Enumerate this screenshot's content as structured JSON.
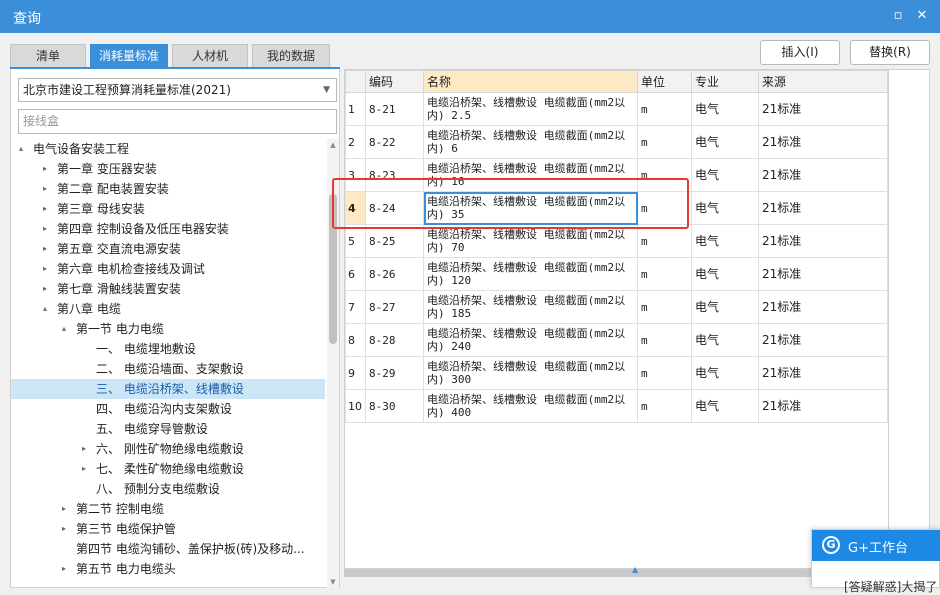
{
  "window": {
    "title": "查询",
    "minimize_icon": "minimize-icon",
    "close_icon": "close-icon"
  },
  "tabs": [
    {
      "label": "清单"
    },
    {
      "label": "消耗量标准"
    },
    {
      "label": "人材机"
    },
    {
      "label": "我的数据"
    }
  ],
  "toolbar": {
    "insert_label": "插入(I)",
    "replace_label": "替换(R)"
  },
  "left": {
    "standard_select": "北京市建设工程预算消耗量标准(2021)",
    "search_placeholder": "接线盒",
    "tree": [
      {
        "label": "电气设备安装工程",
        "exp": "▴"
      },
      {
        "label": "第一章 变压器安装",
        "exp": "▸"
      },
      {
        "label": "第二章 配电装置安装",
        "exp": "▸"
      },
      {
        "label": "第三章 母线安装",
        "exp": "▸"
      },
      {
        "label": "第四章 控制设备及低压电器安装",
        "exp": "▸"
      },
      {
        "label": "第五章 交直流电源安装",
        "exp": "▸"
      },
      {
        "label": "第六章 电机检查接线及调试",
        "exp": "▸"
      },
      {
        "label": "第七章 滑触线装置安装",
        "exp": "▸"
      },
      {
        "label": "第八章 电缆",
        "exp": "▴"
      },
      {
        "label": "第一节 电力电缆",
        "exp": "▴"
      },
      {
        "label": "一、 电缆埋地敷设",
        "exp": ""
      },
      {
        "label": "二、 电缆沿墙面、支架敷设",
        "exp": ""
      },
      {
        "label": "三、 电缆沿桥架、线槽敷设",
        "exp": ""
      },
      {
        "label": "四、 电缆沿沟内支架敷设",
        "exp": ""
      },
      {
        "label": "五、 电缆穿导管敷设",
        "exp": ""
      },
      {
        "label": "六、 刚性矿物绝缘电缆敷设",
        "exp": "▸"
      },
      {
        "label": "七、 柔性矿物绝缘电缆敷设",
        "exp": "▸"
      },
      {
        "label": "八、 预制分支电缆敷设",
        "exp": ""
      },
      {
        "label": "第二节 控制电缆",
        "exp": "▸"
      },
      {
        "label": "第三节 电缆保护管",
        "exp": "▸"
      },
      {
        "label": "第四节 电缆沟铺砂、盖保护板(砖)及移动...",
        "exp": ""
      },
      {
        "label": "第五节 电力电缆头",
        "exp": "▸"
      }
    ]
  },
  "grid": {
    "headers": [
      "",
      "编码",
      "名称",
      "单位",
      "专业",
      "来源"
    ],
    "rows": [
      {
        "idx": "1",
        "code": "8-21",
        "name1": "电缆沿桥架、线槽敷设 电缆截面(mm2以",
        "name2": "内) 2.5",
        "unit": "m",
        "major": "电气",
        "source": "21标准"
      },
      {
        "idx": "2",
        "code": "8-22",
        "name1": "电缆沿桥架、线槽敷设 电缆截面(mm2以",
        "name2": "内) 6",
        "unit": "m",
        "major": "电气",
        "source": "21标准"
      },
      {
        "idx": "3",
        "code": "8-23",
        "name1": "电缆沿桥架、线槽敷设 电缆截面(mm2以",
        "name2": "内) 16",
        "unit": "m",
        "major": "电气",
        "source": "21标准"
      },
      {
        "idx": "4",
        "code": "8-24",
        "name1": "电缆沿桥架、线槽敷设 电缆截面(mm2以",
        "name2": "内) 35",
        "unit": "m",
        "major": "电气",
        "source": "21标准"
      },
      {
        "idx": "5",
        "code": "8-25",
        "name1": "电缆沿桥架、线槽敷设 电缆截面(mm2以",
        "name2": "内) 70",
        "unit": "m",
        "major": "电气",
        "source": "21标准"
      },
      {
        "idx": "6",
        "code": "8-26",
        "name1": "电缆沿桥架、线槽敷设 电缆截面(mm2以",
        "name2": "内) 120",
        "unit": "m",
        "major": "电气",
        "source": "21标准"
      },
      {
        "idx": "7",
        "code": "8-27",
        "name1": "电缆沿桥架、线槽敷设 电缆截面(mm2以",
        "name2": "内) 185",
        "unit": "m",
        "major": "电气",
        "source": "21标准"
      },
      {
        "idx": "8",
        "code": "8-28",
        "name1": "电缆沿桥架、线槽敷设 电缆截面(mm2以",
        "name2": "内) 240",
        "unit": "m",
        "major": "电气",
        "source": "21标准"
      },
      {
        "idx": "9",
        "code": "8-29",
        "name1": "电缆沿桥架、线槽敷设 电缆截面(mm2以",
        "name2": "内) 300",
        "unit": "m",
        "major": "电气",
        "source": "21标准"
      },
      {
        "idx": "10",
        "code": "8-30",
        "name1": "电缆沿桥架、线槽敷设 电缆截面(mm2以",
        "name2": "内) 400",
        "unit": "m",
        "major": "电气",
        "source": "21标准"
      }
    ]
  },
  "gplus": {
    "title": "G+工作台",
    "message": "[答疑解惑]大揭了"
  },
  "colors": {
    "accent": "#3b8fd9",
    "highlight": "#e53935",
    "header_name_bg": "#fde9c3"
  }
}
